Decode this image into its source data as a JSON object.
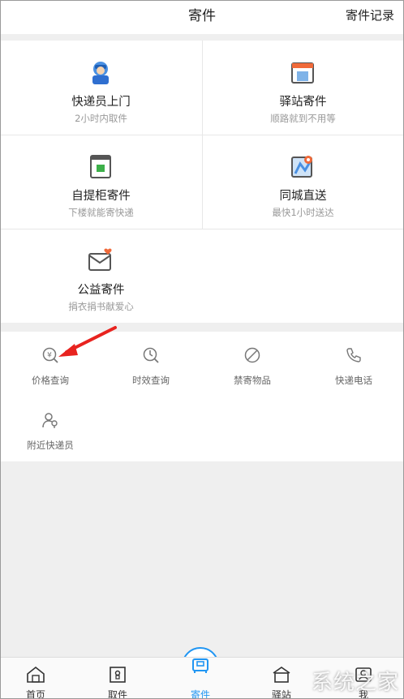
{
  "header": {
    "title": "寄件",
    "right_link": "寄件记录"
  },
  "services": [
    {
      "title": "快递员上门",
      "sub": "2小时内取件",
      "icon": "courier-icon"
    },
    {
      "title": "驿站寄件",
      "sub": "顺路就到不用等",
      "icon": "station-icon"
    },
    {
      "title": "自提柜寄件",
      "sub": "下楼就能寄快递",
      "icon": "locker-icon"
    },
    {
      "title": "同城直送",
      "sub": "最快1小时送达",
      "icon": "map-icon"
    },
    {
      "title": "公益寄件",
      "sub": "捐衣捐书献爱心",
      "icon": "charity-icon"
    }
  ],
  "tools": [
    {
      "label": "价格查询",
      "icon": "price-search-icon"
    },
    {
      "label": "时效查询",
      "icon": "time-search-icon"
    },
    {
      "label": "禁寄物品",
      "icon": "forbidden-icon"
    },
    {
      "label": "快递电话",
      "icon": "phone-icon"
    },
    {
      "label": "附近快递员",
      "icon": "nearby-courier-icon"
    }
  ],
  "tabbar": {
    "items": [
      {
        "label": "首页",
        "icon": "home-icon"
      },
      {
        "label": "取件",
        "icon": "pickup-icon"
      },
      {
        "label": "寄件",
        "icon": "send-icon",
        "active": true
      },
      {
        "label": "驿站",
        "icon": "station-tab-icon"
      },
      {
        "label": "我",
        "icon": "profile-icon"
      }
    ]
  },
  "watermark": "系统之家",
  "colors": {
    "accent": "#2196f3",
    "annotation_arrow": "#e8231f"
  }
}
